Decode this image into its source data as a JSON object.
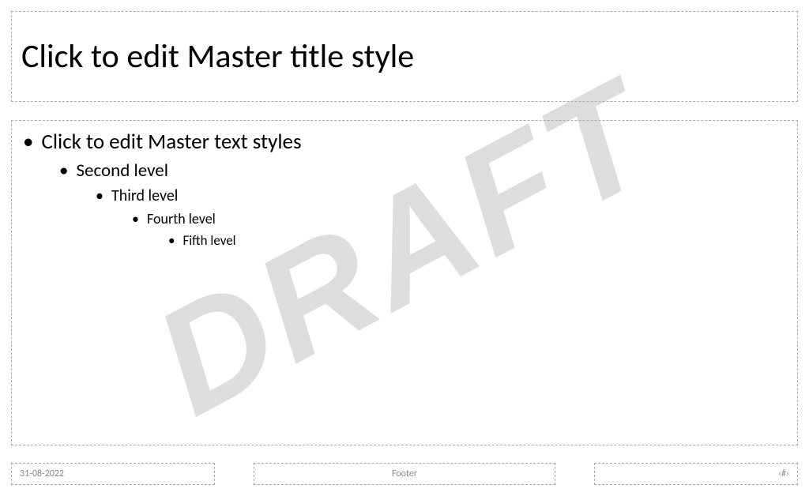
{
  "watermark": "DRAFT",
  "title": "Click to edit Master title style",
  "content": {
    "level1": "Click to edit Master text styles",
    "level2": "Second level",
    "level3": "Third level",
    "level4": "Fourth level",
    "level5": "Fifth level"
  },
  "footer": {
    "date": "31-08-2022",
    "center": "Footer",
    "number": "‹#›"
  }
}
